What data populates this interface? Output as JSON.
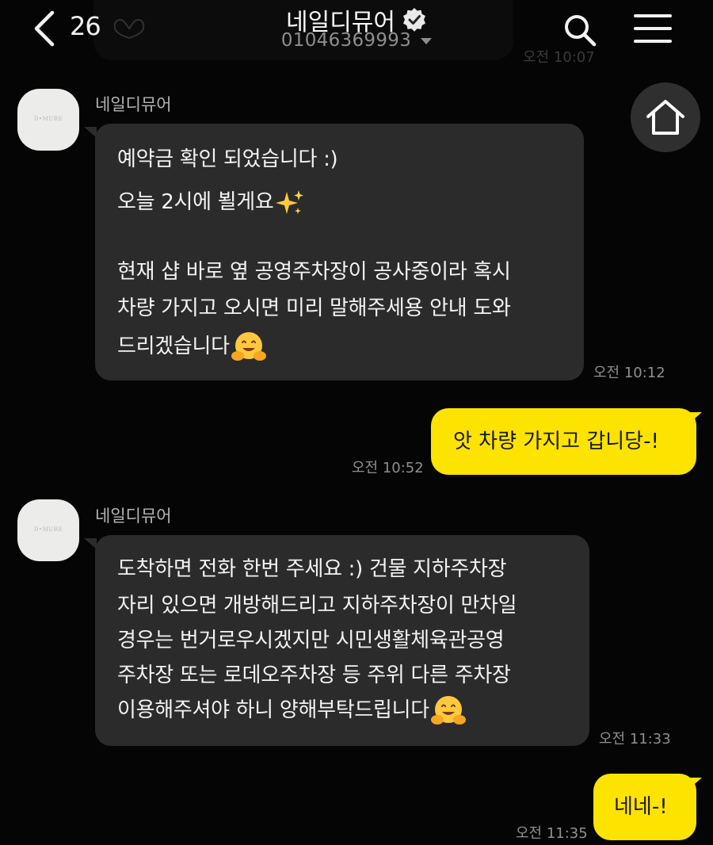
{
  "header": {
    "unread_count": "26",
    "title": "네일디뮤어",
    "phone": "01046369993",
    "ghost_time": "오전 10:07"
  },
  "messages": [
    {
      "sender": "네일디뮤어",
      "lines": [
        "예약금 확인 되었습니다 :)",
        "오늘 2시에 뵐게요",
        "현재 샵 바로 옆 공영주차장이 공사중이라 혹시",
        "차량 가지고 오시면 미리 말해주세용 안내 도와",
        "드리겠습니다"
      ],
      "time": "오전 10:12"
    },
    {
      "text": "앗 차량 가지고 갑니당-!",
      "time": "오전 10:52"
    },
    {
      "sender": "네일디뮤어",
      "lines": [
        "도착하면 전화 한번 주세요 :) 건물 지하주차장",
        "자리 있으면 개방해드리고 지하주차장이 만차일",
        "경우는 번거로우시겠지만 시민생활체육관공영",
        "주차장 또는 로데오주차장 등 주위 다른 주차장",
        "이용해주셔야 하니 양해부탁드립니다"
      ],
      "time": "오전 11:33"
    },
    {
      "text": "네네-!",
      "time": "오전 11:35"
    }
  ],
  "avatar_logo_text": "D•MURE",
  "icons": [
    "back-icon",
    "heart-hands-icon",
    "verified-icon",
    "search-icon",
    "menu-icon",
    "home-icon",
    "sparkles-emoji",
    "hugging-face-emoji"
  ],
  "colors": {
    "background": "#050505",
    "incoming_bubble": "#2b2b2b",
    "outgoing_bubble": "#fde300",
    "timestamp": "#8f8f8f"
  }
}
